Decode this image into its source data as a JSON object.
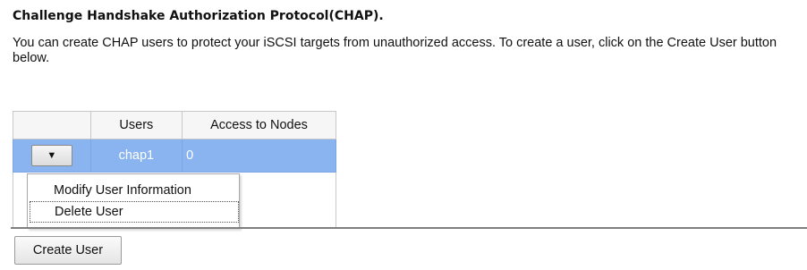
{
  "section": {
    "title": "Challenge Handshake Authorization Protocol(CHAP).",
    "description": "You can create CHAP users to protect your iSCSI targets from unauthorized access. To create a user, click on the Create User button below."
  },
  "table": {
    "columns": [
      "",
      "Users",
      "Access to Nodes"
    ],
    "rows": [
      {
        "action_glyph": "▼",
        "user": "chap1",
        "access": "0"
      }
    ]
  },
  "context_menu": {
    "items": [
      "Modify User Information",
      "Delete User"
    ]
  },
  "buttons": {
    "create_user": "Create User"
  },
  "colors": {
    "selected_row": "#8ab4f0",
    "separator": "#7f7f7f"
  }
}
